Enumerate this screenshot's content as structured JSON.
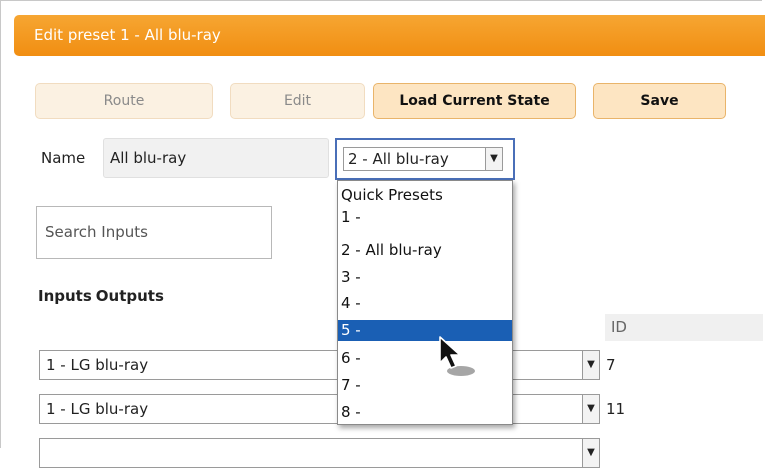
{
  "header": {
    "title": "Edit preset 1 - All blu-ray"
  },
  "toolbar": {
    "route_label": "Route",
    "edit_label": "Edit",
    "load_label": "Load Current State",
    "save_label": "Save"
  },
  "name": {
    "label": "Name",
    "value": "All blu-ray"
  },
  "preset_select": {
    "value": "2 - All blu-ray",
    "options": [
      {
        "label": "Quick Presets"
      },
      {
        "label": "1 -"
      },
      {
        "label": "2 - All blu-ray"
      },
      {
        "label": "3 -"
      },
      {
        "label": "4 -"
      },
      {
        "label": "5 -"
      },
      {
        "label": "6 -"
      },
      {
        "label": "7 -"
      },
      {
        "label": "8 -"
      }
    ],
    "highlighted": "5 -"
  },
  "search": {
    "placeholder": "Search Inputs"
  },
  "tabs": {
    "inputs": "Inputs",
    "outputs": "Outputs"
  },
  "grid": {
    "id_header": "ID",
    "rows": [
      {
        "input": "1 - LG blu-ray",
        "id": "7"
      },
      {
        "input": "1 - LG blu-ray",
        "id": "11"
      }
    ]
  },
  "colors": {
    "accent": "#f39a1f",
    "selection": "#1a5fb4"
  },
  "icons": {
    "dropdown": "chevron-down-icon",
    "cursor": "mouse-pointer-icon"
  }
}
